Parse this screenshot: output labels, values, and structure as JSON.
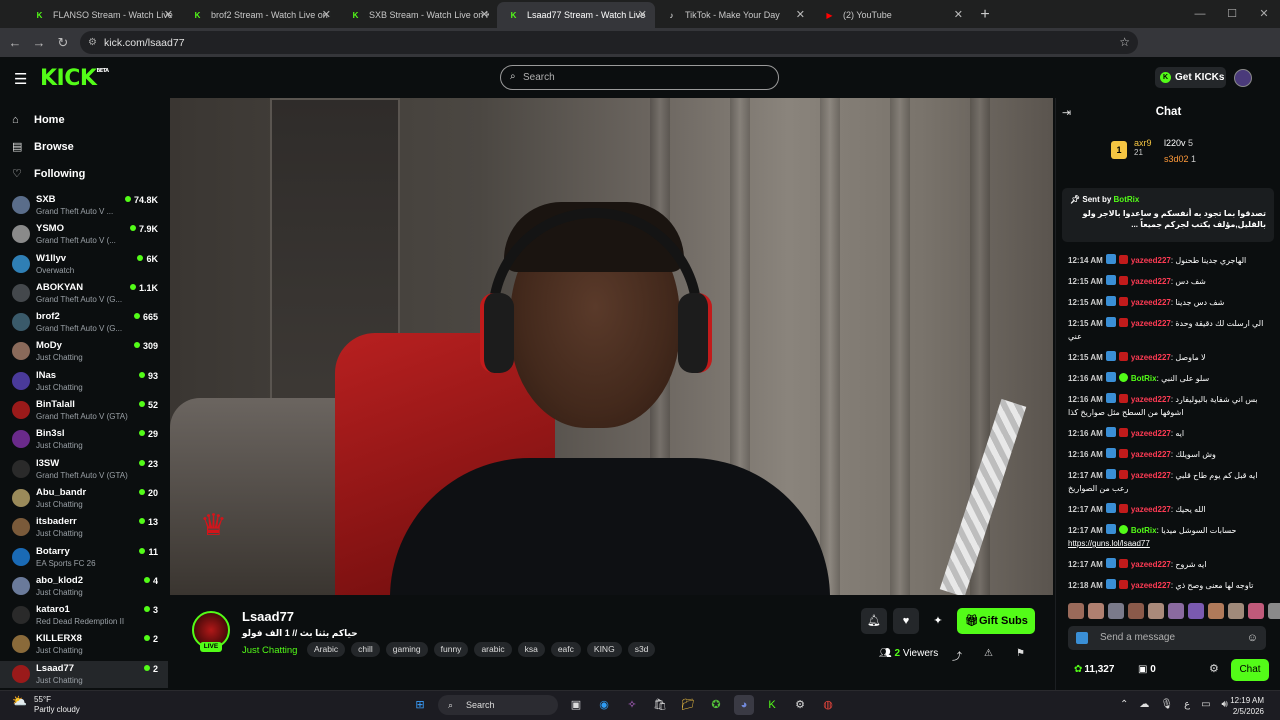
{
  "browser": {
    "tabs": [
      {
        "label": "FLANSO Stream - Watch Live o",
        "icon_color": "#53fc18",
        "icon": "K"
      },
      {
        "label": "brof2 Stream - Watch Live on K",
        "icon_color": "#53fc18",
        "icon": "K"
      },
      {
        "label": "SXB Stream - Watch Live on Ki",
        "icon_color": "#53fc18",
        "icon": "K"
      },
      {
        "label": "Lsaad77 Stream - Watch Live o",
        "icon_color": "#53fc18",
        "icon": "K",
        "active": true
      },
      {
        "label": "TikTok - Make Your Day",
        "icon_color": "#ffffff",
        "icon": "♪"
      },
      {
        "label": "(2) YouTube",
        "icon_color": "#ff0000",
        "icon": "▶"
      }
    ],
    "url": "kick.com/lsaad77"
  },
  "header": {
    "logo": "KICK",
    "logo_badge": "BETA",
    "search_placeholder": "Search",
    "get_kicks_label": "Get KICKs"
  },
  "sidebar": {
    "nav": [
      {
        "label": "Home",
        "icon": "home-icon"
      },
      {
        "label": "Browse",
        "icon": "browse-icon"
      },
      {
        "label": "Following",
        "icon": "heart-icon"
      }
    ],
    "channels": [
      {
        "name": "SXB",
        "category": "Grand Theft Auto V ...",
        "viewers": "74.8K",
        "color": "#5a6d8a"
      },
      {
        "name": "YSMO",
        "category": "Grand Theft Auto V (...",
        "viewers": "7.9K",
        "color": "#8a8a8a"
      },
      {
        "name": "W1llyv",
        "category": "Overwatch",
        "viewers": "6K",
        "color": "#2f7fb5"
      },
      {
        "name": "ABOKYAN",
        "category": "Grand Theft Auto V (G...",
        "viewers": "1.1K",
        "color": "#44484c"
      },
      {
        "name": "brof2",
        "category": "Grand Theft Auto V (G...",
        "viewers": "665",
        "color": "#3a5a6a"
      },
      {
        "name": "MoDy",
        "category": "Just Chatting",
        "viewers": "309",
        "color": "#8a6a5a"
      },
      {
        "name": "lNas",
        "category": "Just Chatting",
        "viewers": "93",
        "color": "#4a3a9a"
      },
      {
        "name": "BinTalall",
        "category": "Grand Theft Auto V (GTA)",
        "viewers": "52",
        "color": "#9a1a1a"
      },
      {
        "name": "Bin3sl",
        "category": "Just Chatting",
        "viewers": "29",
        "color": "#6a2a8a"
      },
      {
        "name": "l3SW",
        "category": "Grand Theft Auto V (GTA)",
        "viewers": "23",
        "color": "#2a2a2a"
      },
      {
        "name": "Abu_bandr",
        "category": "Just Chatting",
        "viewers": "20",
        "color": "#9a8a5a"
      },
      {
        "name": "itsbaderr",
        "category": "Just Chatting",
        "viewers": "13",
        "color": "#7a5a3a"
      },
      {
        "name": "Botarry",
        "category": "EA Sports FC 26",
        "viewers": "11",
        "color": "#1a6ab5"
      },
      {
        "name": "abo_klod2",
        "category": "Just Chatting",
        "viewers": "4",
        "color": "#6a7a9a"
      },
      {
        "name": "kataro1",
        "category": "Red Dead Redemption II",
        "viewers": "3",
        "color": "#2a2a2a"
      },
      {
        "name": "KILLERX8",
        "category": "Just Chatting",
        "viewers": "2",
        "color": "#8a6a3a"
      },
      {
        "name": "Lsaad77",
        "category": "Just Chatting",
        "viewers": "2",
        "color": "#9a1a1a",
        "active": true
      }
    ]
  },
  "stream": {
    "name": "Lsaad77",
    "title": "حياكم بثنا بث // 1 الف فولو",
    "category": "Just Chatting",
    "live_badge": "LIVE",
    "tags": [
      "Arabic",
      "chill",
      "gaming",
      "funny",
      "arabic",
      "ksa",
      "eafc",
      "KING",
      "s3d"
    ],
    "gift_subs_label": "Gift Subs",
    "viewers_count": "2",
    "viewers_label": "Viewers"
  },
  "chat": {
    "title": "Chat",
    "leaderboard": [
      {
        "name": "axr9",
        "value": "21",
        "color": "#f5c542"
      },
      {
        "name": "l220v",
        "value": "5",
        "color": "#ffffff"
      },
      {
        "name": "s3d02",
        "value": "1",
        "color": "#ff9a3a"
      }
    ],
    "pinned": {
      "sent_by_label": "Sent by",
      "user": "BotRix",
      "text": "تصدقوا بما تجود به أنفسكم و ساعدوا بالاجر ولو بالقليل,مؤلف يكتب لجركم جميعاً ..."
    },
    "messages": [
      {
        "time": "12:14 AM",
        "user": "yazeed227",
        "text": "الهاجري جدينا طحنول",
        "bot": false
      },
      {
        "time": "12:15 AM",
        "user": "yazeed227",
        "text": "شف دس",
        "bot": false
      },
      {
        "time": "12:15 AM",
        "user": "yazeed227",
        "text": "شف دس جدينا",
        "bot": false
      },
      {
        "time": "12:15 AM",
        "user": "yazeed227",
        "text": "الي ارسلت لك دقيقة وحدة عني",
        "bot": false
      },
      {
        "time": "12:15 AM",
        "user": "yazeed227",
        "text": "لا ماوصل",
        "bot": false
      },
      {
        "time": "12:16 AM",
        "user": "BotRix",
        "text": "سلو على النبي",
        "bot": true
      },
      {
        "time": "12:16 AM",
        "user": "yazeed227",
        "text": "بس اني شفاية باليوليفارد اشوفها من السطح مثل صواريخ كذا",
        "bot": false
      },
      {
        "time": "12:16 AM",
        "user": "yazeed227",
        "text": "ايه",
        "bot": false
      },
      {
        "time": "12:16 AM",
        "user": "yazeed227",
        "text": "وش اسويلك",
        "bot": false
      },
      {
        "time": "12:17 AM",
        "user": "yazeed227",
        "text": "ايه قبل كم يوم طاح قلبي رعب من الصواريخ",
        "bot": false
      },
      {
        "time": "12:17 AM",
        "user": "yazeed227",
        "text": "الله يحيك",
        "bot": false
      },
      {
        "time": "12:17 AM",
        "user": "BotRix",
        "text": "حسابات السوشل ميديا",
        "link": "https://guns.lol/lsaad77",
        "bot": true
      },
      {
        "time": "12:17 AM",
        "user": "yazeed227",
        "text": "ايه شروح",
        "bot": false
      },
      {
        "time": "12:18 AM",
        "user": "yazeed227",
        "text": "تاوجه لها معنى وصح ذي",
        "bot": false
      }
    ],
    "send_placeholder": "Send a message",
    "kicks_balance": "11,327",
    "tokens": "0",
    "chat_button": "Chat"
  },
  "taskbar": {
    "temperature": "55°F",
    "weather": "Partly cloudy",
    "search_label": "Search",
    "time": "12:19 AM",
    "date": "2/5/2026"
  }
}
